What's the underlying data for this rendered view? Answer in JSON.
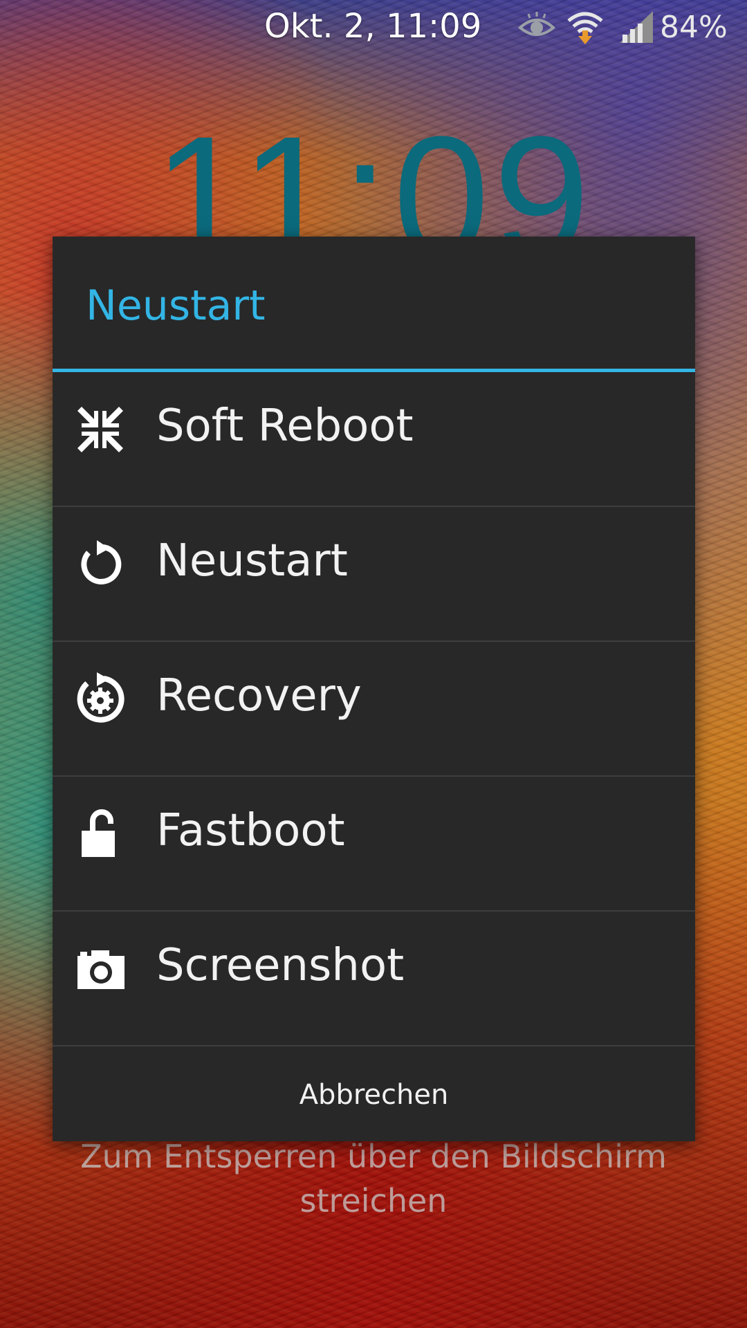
{
  "status_bar": {
    "datetime": "Okt. 2, 11:09",
    "battery": "84%",
    "icons": [
      "eye-icon",
      "wifi-icon",
      "signal-icon"
    ]
  },
  "lockscreen": {
    "clock": "11:09",
    "unlock_hint": "Zum Entsperren über den Bildschirm streichen"
  },
  "dialog": {
    "title": "Neustart",
    "accent_color": "#33b5e5",
    "items": [
      {
        "label": "Soft Reboot",
        "icon": "soft-reboot-icon"
      },
      {
        "label": "Neustart",
        "icon": "restart-icon"
      },
      {
        "label": "Recovery",
        "icon": "recovery-icon"
      },
      {
        "label": "Fastboot",
        "icon": "unlock-icon"
      },
      {
        "label": "Screenshot",
        "icon": "camera-icon"
      }
    ],
    "cancel_label": "Abbrechen"
  }
}
